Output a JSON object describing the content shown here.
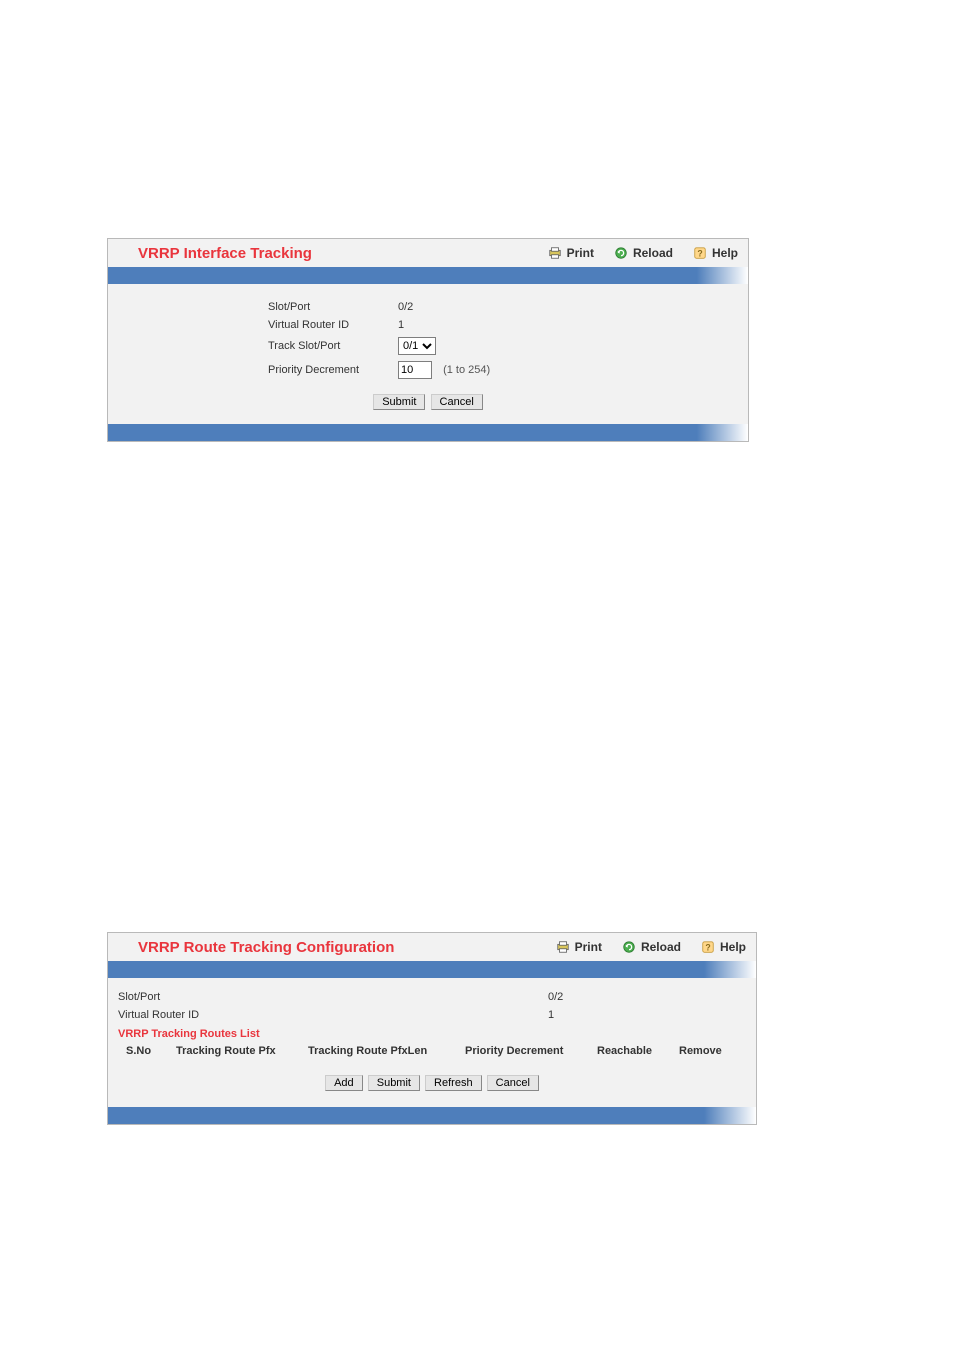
{
  "header_actions": {
    "print": "Print",
    "reload": "Reload",
    "help": "Help"
  },
  "panel1": {
    "title": "VRRP Interface Tracking",
    "fields": {
      "slot_port_label": "Slot/Port",
      "slot_port_value": "0/2",
      "vrid_label": "Virtual Router ID",
      "vrid_value": "1",
      "track_slot_port_label": "Track Slot/Port",
      "track_slot_port_value": "0/1",
      "priority_dec_label": "Priority Decrement",
      "priority_dec_value": "10",
      "priority_dec_hint": "(1 to 254)"
    },
    "buttons": {
      "submit": "Submit",
      "cancel": "Cancel"
    }
  },
  "panel2": {
    "title": "VRRP Route Tracking Configuration",
    "fields": {
      "slot_port_label": "Slot/Port",
      "slot_port_value": "0/2",
      "vrid_label": "Virtual Router ID",
      "vrid_value": "1",
      "list_title": "VRRP Tracking Routes List"
    },
    "columns": {
      "sno": "S.No",
      "pfx": "Tracking Route Pfx",
      "pfxlen": "Tracking Route PfxLen",
      "priority": "Priority Decrement",
      "reachable": "Reachable",
      "remove": "Remove"
    },
    "buttons": {
      "add": "Add",
      "submit": "Submit",
      "refresh": "Refresh",
      "cancel": "Cancel"
    }
  }
}
